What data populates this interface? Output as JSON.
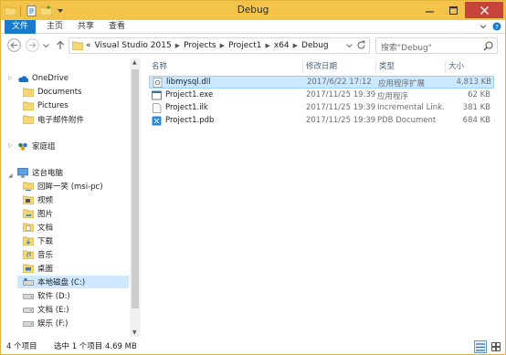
{
  "window": {
    "title": "Debug",
    "accent": "#f4c44a"
  },
  "quick_access": {
    "icons": [
      "properties-icon",
      "new-folder-icon",
      "customize-dropdown-icon"
    ]
  },
  "ribbon": {
    "tabs": [
      {
        "label": "文件",
        "active": true
      },
      {
        "label": "主页"
      },
      {
        "label": "共享"
      },
      {
        "label": "查看"
      }
    ]
  },
  "address_bar": {
    "chevron": "«",
    "crumbs": [
      "Visual Studio 2015",
      "Projects",
      "Project1",
      "x64",
      "Debug"
    ]
  },
  "search": {
    "placeholder": "搜索\"Debug\""
  },
  "nav_pane": {
    "onedrive": "OneDrive",
    "onedrive_children": [
      "Documents",
      "Pictures",
      "电子邮件附件"
    ],
    "homegroup": "家庭组",
    "this_pc": "这台电脑",
    "pc_children": [
      "回眸一笑 (msi-pc)",
      "视频",
      "图片",
      "文档",
      "下载",
      "音乐",
      "桌面",
      "本地磁盘 (C:)",
      "软件 (D:)",
      "文档 (E:)",
      "娱乐 (F:)"
    ],
    "selected": "本地磁盘 (C:)"
  },
  "columns": {
    "name": "名称",
    "date": "修改日期",
    "type": "类型",
    "size": "大小"
  },
  "files": [
    {
      "name": "libmysql.dll",
      "date": "2017/6/22 17:12",
      "type": "应用程序扩展",
      "size": "4,813 KB",
      "icon": "dll-file-icon",
      "selected": true
    },
    {
      "name": "Project1.exe",
      "date": "2017/11/25 19:39",
      "type": "应用程序",
      "size": "62 KB",
      "icon": "exe-file-icon"
    },
    {
      "name": "Project1.ilk",
      "date": "2017/11/25 19:39",
      "type": "Incremental Link...",
      "size": "381 KB",
      "icon": "ilk-file-icon"
    },
    {
      "name": "Project1.pdb",
      "date": "2017/11/25 19:39",
      "type": "PDB Document",
      "size": "684 KB",
      "icon": "pdb-file-icon"
    }
  ],
  "status": {
    "count": "4 个项目",
    "selection": "选中 1 个项目  4.69 MB"
  }
}
